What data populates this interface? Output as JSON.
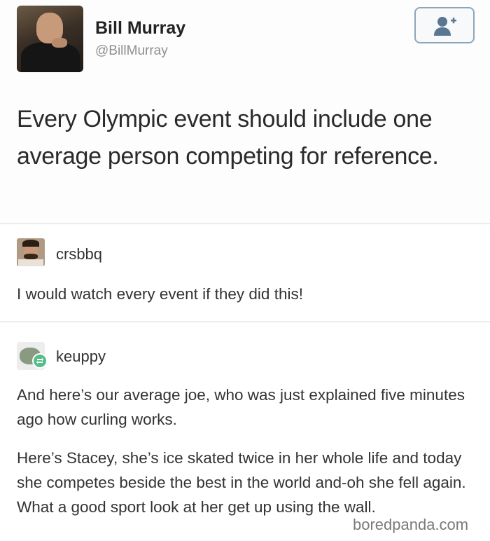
{
  "tweet": {
    "author_name": "Bill Murray",
    "author_handle": "@BillMurray",
    "text": "Every Olympic event should include one average person competing for reference.",
    "follow_icon": "add-user-icon"
  },
  "replies": [
    {
      "username": "crsbbq",
      "text": "I would watch every event if they did this!"
    },
    {
      "username": "keuppy",
      "paragraphs": [
        "And here’s our average joe, who was just explained five minutes ago how curling works.",
        "Here’s Stacey, she’s ice skated twice in her whole life and today she competes beside the best in the world and-oh she fell again. What a good sport look at her get up using the wall."
      ]
    }
  ],
  "watermark": "boredpanda.com",
  "colors": {
    "follow_border": "#8fa6b8",
    "follow_icon": "#5a7690",
    "reblog_badge": "#56bc8a",
    "handle": "#8f8f8f"
  }
}
